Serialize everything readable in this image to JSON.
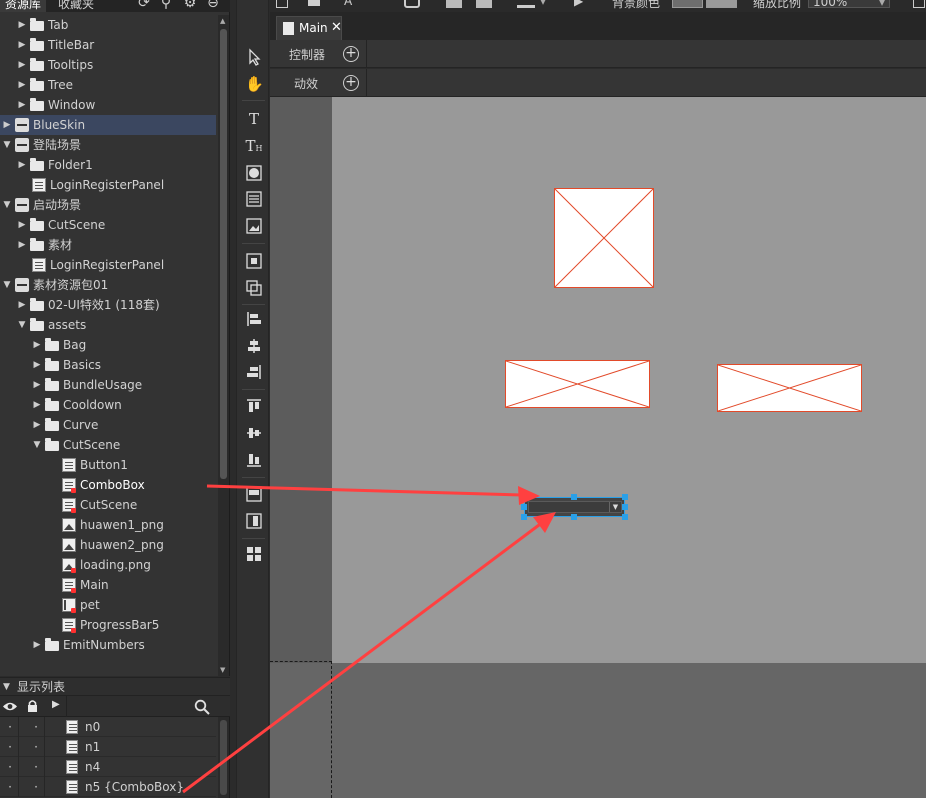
{
  "resource_tabs": [
    {
      "label": "资源库",
      "active": true
    },
    {
      "label": "收藏夹",
      "active": false
    }
  ],
  "tree": [
    {
      "label": "Tab",
      "icon": "folder",
      "depth": 1,
      "expanded": false
    },
    {
      "label": "TitleBar",
      "icon": "folder",
      "depth": 1,
      "expanded": false
    },
    {
      "label": "Tooltips",
      "icon": "folder",
      "depth": 1,
      "expanded": false
    },
    {
      "label": "Tree",
      "icon": "folder",
      "depth": 1,
      "expanded": false
    },
    {
      "label": "Window",
      "icon": "folder",
      "depth": 1,
      "expanded": false
    },
    {
      "label": "BlueSkin",
      "icon": "package",
      "depth": 0,
      "expanded": false,
      "selected": true
    },
    {
      "label": "登陆场景",
      "icon": "package",
      "depth": 0,
      "expanded": true
    },
    {
      "label": "Folder1",
      "icon": "folder",
      "depth": 1,
      "expanded": false
    },
    {
      "label": "LoginRegisterPanel",
      "icon": "component",
      "depth": 1,
      "leaf": true
    },
    {
      "label": "启动场景",
      "icon": "package",
      "depth": 0,
      "expanded": true
    },
    {
      "label": "CutScene",
      "icon": "folder",
      "depth": 1,
      "expanded": false
    },
    {
      "label": "素材",
      "icon": "folder",
      "depth": 1,
      "expanded": false
    },
    {
      "label": "LoginRegisterPanel",
      "icon": "component",
      "depth": 1,
      "leaf": true
    },
    {
      "label": "素材资源包01",
      "icon": "package",
      "depth": 0,
      "expanded": true
    },
    {
      "label": "02-UI特效1 (118套)",
      "icon": "folder",
      "depth": 1,
      "expanded": false
    },
    {
      "label": "assets",
      "icon": "folder",
      "depth": 1,
      "expanded": true
    },
    {
      "label": "Bag",
      "icon": "folder",
      "depth": 2,
      "expanded": false
    },
    {
      "label": "Basics",
      "icon": "folder",
      "depth": 2,
      "expanded": false
    },
    {
      "label": "BundleUsage",
      "icon": "folder",
      "depth": 2,
      "expanded": false
    },
    {
      "label": "Cooldown",
      "icon": "folder",
      "depth": 2,
      "expanded": false
    },
    {
      "label": "Curve",
      "icon": "folder",
      "depth": 2,
      "expanded": false
    },
    {
      "label": "CutScene",
      "icon": "folder",
      "depth": 2,
      "expanded": true
    },
    {
      "label": "Button1",
      "icon": "component",
      "depth": 3,
      "leaf": true
    },
    {
      "label": "ComboBox",
      "icon": "component",
      "depth": 3,
      "leaf": true,
      "exported": true,
      "highlight": true
    },
    {
      "label": "CutScene",
      "icon": "component",
      "depth": 3,
      "leaf": true,
      "exported": true
    },
    {
      "label": "huawen1_png",
      "icon": "image",
      "depth": 3,
      "leaf": true
    },
    {
      "label": "huawen2_png",
      "icon": "image",
      "depth": 3,
      "leaf": true
    },
    {
      "label": "loading.png",
      "icon": "image",
      "depth": 3,
      "leaf": true,
      "exported": true
    },
    {
      "label": "Main",
      "icon": "component",
      "depth": 3,
      "leaf": true,
      "exported": true
    },
    {
      "label": "pet",
      "icon": "movieclip",
      "depth": 3,
      "leaf": true,
      "exported": true
    },
    {
      "label": "ProgressBar5",
      "icon": "component",
      "depth": 3,
      "leaf": true,
      "exported": true
    },
    {
      "label": "EmitNumbers",
      "icon": "folder",
      "depth": 2,
      "expanded": false
    }
  ],
  "display_list": {
    "title": "显示列表",
    "items": [
      {
        "label": "n0"
      },
      {
        "label": "n1"
      },
      {
        "label": "n4"
      },
      {
        "label": "n5 {ComboBox}"
      }
    ]
  },
  "top_toolbar": {
    "bg_color_label": "背景颜色",
    "zoom_label": "缩放比例",
    "zoom_value": "100%"
  },
  "document_tab": {
    "label": "Main",
    "close": "✕"
  },
  "timeline": {
    "controllers_label": "控制器",
    "transitions_label": "动效"
  },
  "colors": {
    "stage": "#999999",
    "placeholder_stroke": "#e24a2a",
    "selection": "#2aa0e8",
    "annotation_arrow": "#ff4040"
  }
}
